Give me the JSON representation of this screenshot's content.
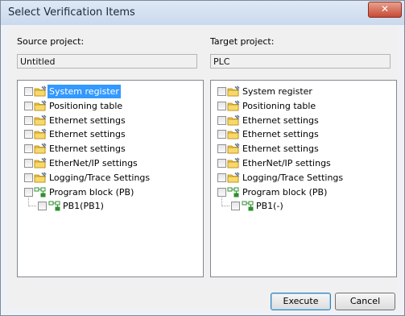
{
  "dialog": {
    "title": "Select Verification Items",
    "close_glyph": "✕"
  },
  "source": {
    "label": "Source project:",
    "name": "Untitled",
    "items": [
      "System register",
      "Positioning table",
      "Ethernet settings",
      "Ethernet settings",
      "Ethernet settings",
      "EtherNet/IP settings",
      "Logging/Trace Settings",
      "Program block (PB)"
    ],
    "child": "PB1(PB1)"
  },
  "target": {
    "label": "Target project:",
    "name": "PLC",
    "items": [
      "System register",
      "Positioning table",
      "Ethernet settings",
      "Ethernet settings",
      "Ethernet settings",
      "EtherNet/IP settings",
      "Logging/Trace Settings",
      "Program block (PB)"
    ],
    "child": "PB1(-)"
  },
  "buttons": {
    "execute": "Execute",
    "cancel": "Cancel"
  },
  "colors": {
    "selection": "#3399ff",
    "pb_icon": "#2f8f2f",
    "folder_icon": "#e8b923"
  },
  "icons": {
    "settings_item": "folder-wrench-icon",
    "program_block": "program-block-icon"
  }
}
